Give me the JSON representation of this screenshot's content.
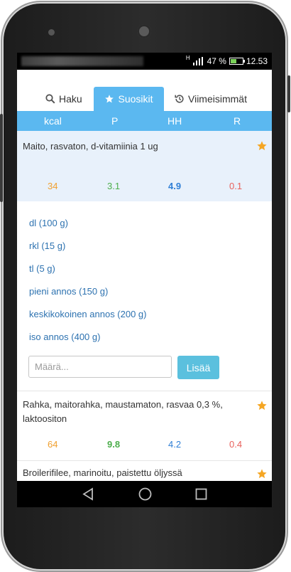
{
  "status": {
    "battery_percent": "47 %",
    "time": "12.53",
    "network": "H",
    "battery_level": 0.47
  },
  "tabs": [
    {
      "label": "Haku",
      "icon": "search-icon"
    },
    {
      "label": "Suosikit",
      "icon": "star-icon",
      "active": true
    },
    {
      "label": "Viimeisimmät",
      "icon": "history-icon"
    }
  ],
  "columns": [
    "kcal",
    "P",
    "HH",
    "R"
  ],
  "items": [
    {
      "name": "Maito, rasvaton, d-vitamiinia 1 ug",
      "kcal": "34",
      "p": "3.1",
      "hh": "4.9",
      "r": "0.1",
      "favorite": true,
      "expanded": true
    },
    {
      "name": "Rahka, maitorahka, maustamaton, rasvaa 0,3 %, laktoositon",
      "kcal": "64",
      "p": "9.8",
      "hh": "4.2",
      "r": "0.4",
      "favorite": true
    },
    {
      "name": "Broilerifilee, marinoitu, paistettu öljyssä",
      "favorite": true
    }
  ],
  "portions": [
    "dl (100 g)",
    "rkl (15 g)",
    "tl (5 g)",
    "pieni annos (150 g)",
    "keskikokoinen annos (200 g)",
    "iso annos (400 g)"
  ],
  "amount": {
    "placeholder": "Määrä...",
    "value": ""
  },
  "add_label": "Lisää",
  "colors": {
    "accent": "#5bb8f0",
    "kcal": "#f0a030",
    "p": "#4cae4c",
    "hh": "#2f7fd6",
    "r": "#e8615c",
    "star": "#f5a623",
    "expanded_bg": "#e8f1fb",
    "link": "#2d72b0"
  }
}
